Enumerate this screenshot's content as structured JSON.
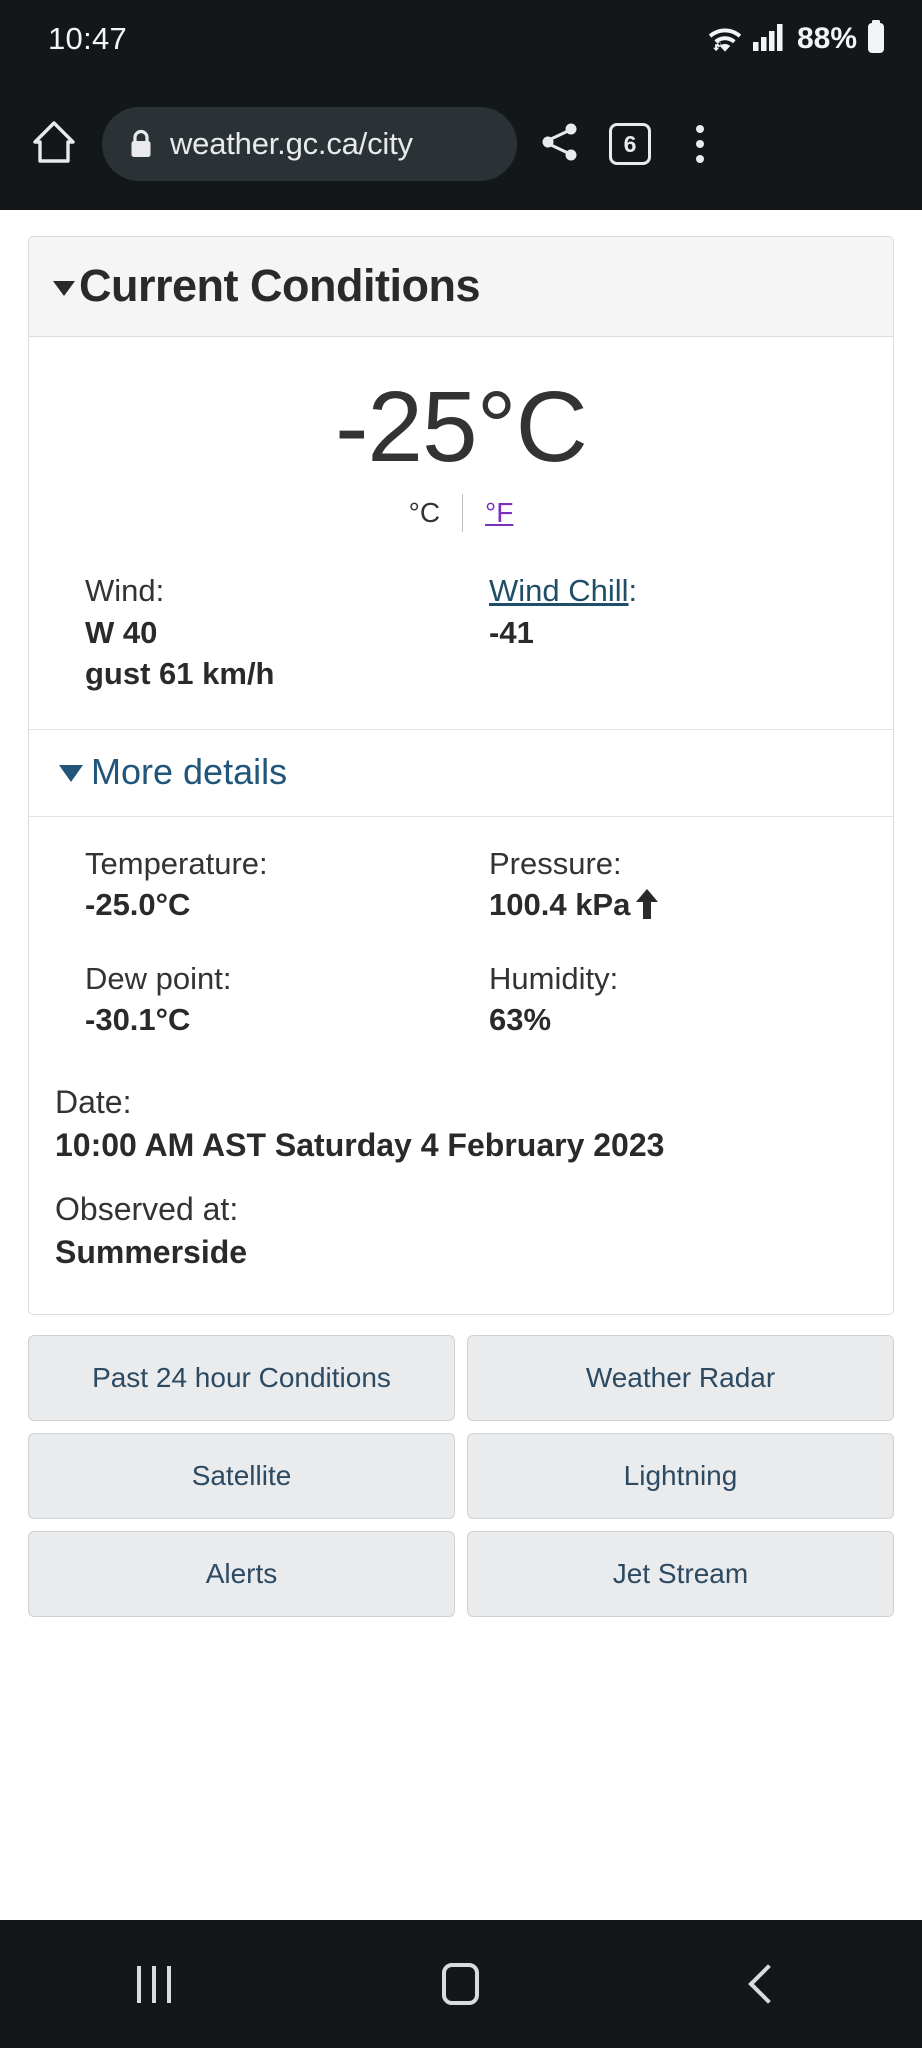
{
  "status_bar": {
    "clock": "10:47",
    "battery_percent": "88%",
    "icons": [
      "wifi-icon",
      "cellular-signal-icon",
      "battery-icon"
    ]
  },
  "browser": {
    "home_icon": "home-icon",
    "lock_icon": "lock-icon",
    "url": "weather.gc.ca/city",
    "share_icon": "share-icon",
    "tab_count": "6",
    "menu_icon": "overflow-menu-icon"
  },
  "current_conditions": {
    "panel_title": "Current Conditions",
    "disclosure_icon": "triangle-down-icon",
    "temperature_display": "-25°C",
    "unit_celsius": "°C",
    "unit_fahrenheit": "°F",
    "wind_label": "Wind:",
    "wind_value_line1": "W 40",
    "wind_value_line2": "gust 61 km/h",
    "wind_chill_label": "Wind Chill",
    "wind_chill_label_suffix": ":",
    "wind_chill_value": "-41"
  },
  "more_details": {
    "toggle_label": "More details",
    "toggle_icon": "triangle-down-icon",
    "fields": [
      {
        "label": "Temperature:",
        "value": "-25.0°C",
        "trend_icon": ""
      },
      {
        "label": "Pressure:",
        "value": "100.4 kPa",
        "trend_icon": "arrow-up-icon"
      },
      {
        "label": "Dew point:",
        "value": "-30.1°C",
        "trend_icon": ""
      },
      {
        "label": "Humidity:",
        "value": "63%",
        "trend_icon": ""
      }
    ],
    "date_label": "Date:",
    "date_value": "10:00 AM AST Saturday 4 February 2023",
    "observed_label": "Observed at:",
    "observed_value": "Summerside"
  },
  "link_buttons": [
    {
      "label": "Past 24 hour Conditions"
    },
    {
      "label": "Weather Radar"
    },
    {
      "label": "Satellite"
    },
    {
      "label": "Lightning"
    },
    {
      "label": "Alerts"
    },
    {
      "label": "Jet Stream"
    }
  ],
  "nav_bar": {
    "recents_icon": "recent-apps-icon",
    "home_icon": "home-square-icon",
    "back_icon": "back-chevron-icon"
  },
  "colors": {
    "chrome_background": "#141719",
    "omnibox_background": "#2b3236",
    "link_blue": "#1f4e68",
    "heading_blue": "#21557a",
    "visited_purple": "#7a2fbf",
    "button_background": "#e9ebec",
    "button_text": "#2d4a63"
  }
}
